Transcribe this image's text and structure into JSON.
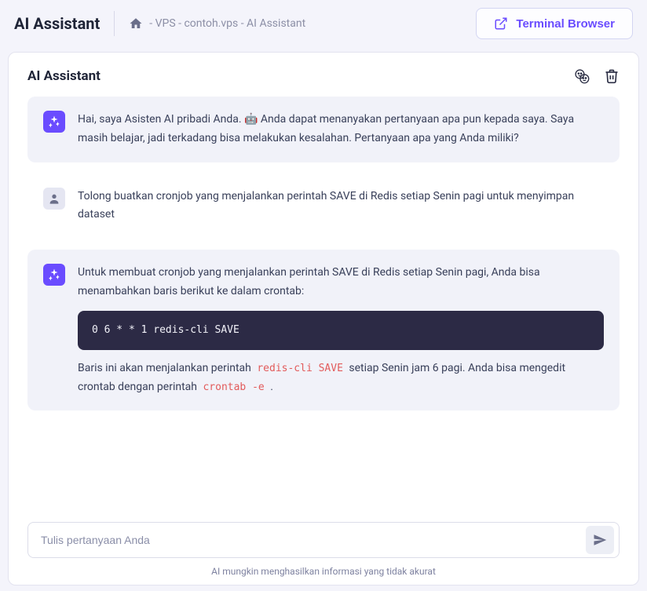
{
  "header": {
    "title": "AI Assistant",
    "breadcrumb": " - VPS - contoh.vps - AI Assistant",
    "terminal_button": "Terminal Browser"
  },
  "card": {
    "title": "AI Assistant"
  },
  "messages": {
    "m0": {
      "text": "Hai, saya Asisten AI pribadi Anda. 🤖 Anda dapat menanyakan pertanyaan apa pun kepada saya. Saya masih belajar, jadi terkadang bisa melakukan kesalahan. Pertanyaan apa yang Anda miliki?"
    },
    "m1": {
      "text": "Tolong buatkan cronjob yang menjalankan perintah SAVE di Redis setiap Senin pagi untuk menyimpan dataset"
    },
    "m2": {
      "intro": "Untuk membuat cronjob yang menjalankan perintah SAVE di Redis setiap Senin pagi, Anda bisa menambahkan baris berikut ke dalam crontab:",
      "code": "0 6 * * 1 redis-cli SAVE",
      "outro_a": "Baris ini akan menjalankan perintah ",
      "inline1": "redis-cli SAVE",
      "outro_b": " setiap Senin jam 6 pagi. Anda bisa mengedit crontab dengan perintah ",
      "inline2": "crontab -e",
      "outro_c": " ."
    }
  },
  "input": {
    "placeholder": "Tulis pertanyaan Anda"
  },
  "disclaimer": "AI mungkin menghasilkan informasi yang tidak akurat"
}
